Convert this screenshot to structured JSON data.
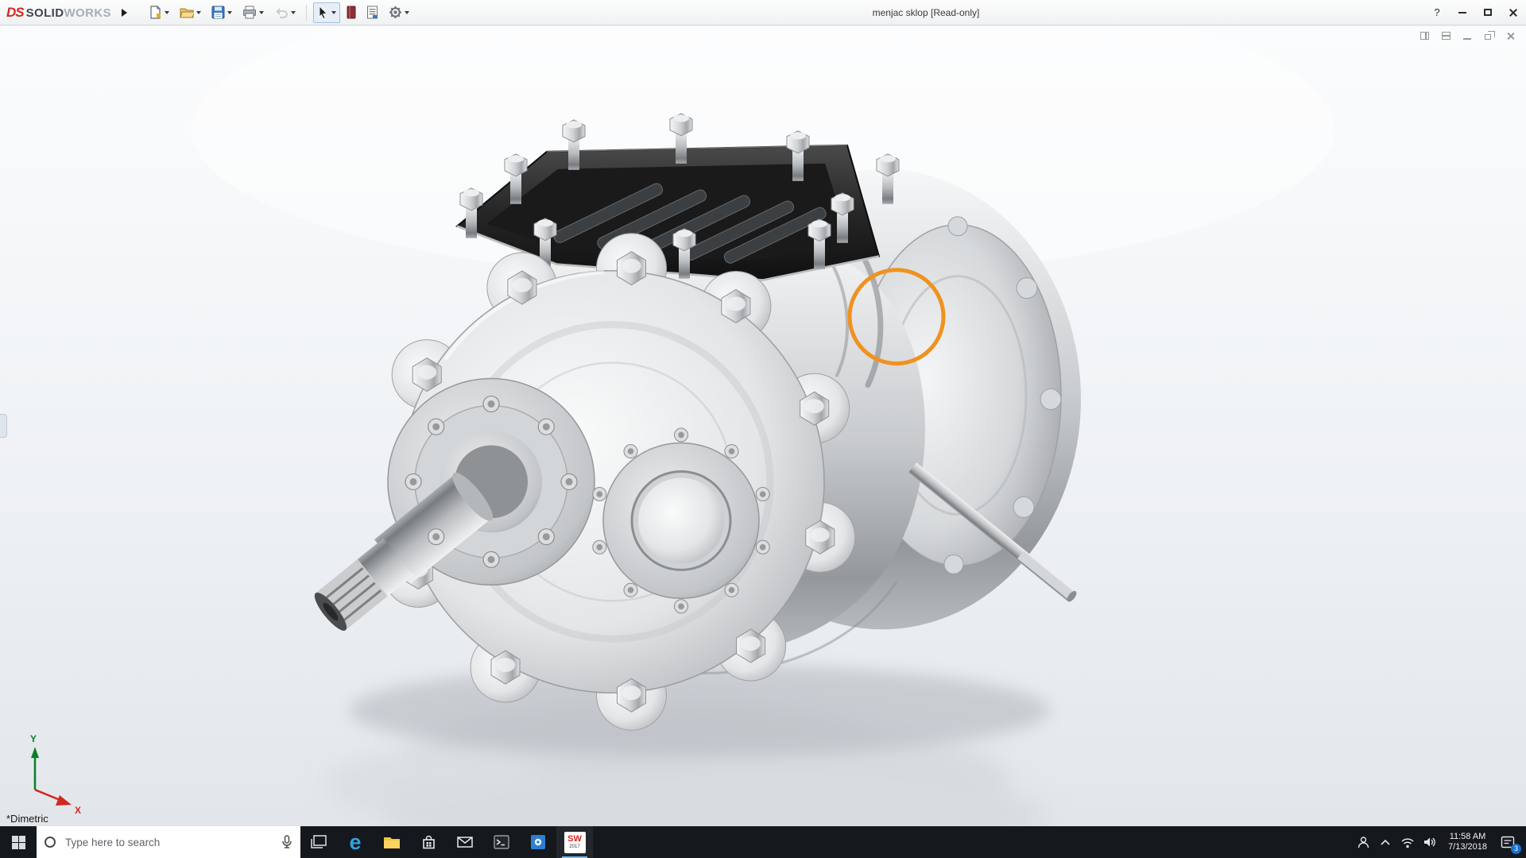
{
  "titlebar": {
    "logo_mark": "DS",
    "logo_solid": "SOLID",
    "logo_works": "WORKS",
    "title": "menjac sklop [Read-only]",
    "help_label": "?",
    "toolbar_icons": [
      "new-document",
      "open-document",
      "save",
      "print",
      "undo",
      "select-cursor",
      "xpress-products",
      "design-binder",
      "options-gear"
    ],
    "window_controls": [
      "help",
      "minimize",
      "maximize",
      "close"
    ]
  },
  "viewport": {
    "view_label": "*Dimetric",
    "doc_window_controls": [
      "split-pane-vertical",
      "split-pane-horizontal",
      "minimize",
      "restore",
      "close"
    ],
    "annotation": {
      "type": "circle",
      "color": "#F0921E"
    },
    "triad": {
      "x_label": "X",
      "y_label": "Y",
      "x_color": "#d2281e",
      "y_color": "#0c7d28"
    },
    "model": {
      "name": "gearbox-assembly",
      "metal_light": "#f4f5f6",
      "metal_mid": "#c9ccd0",
      "metal_dark": "#8f9296",
      "cover_dark": "#262626",
      "background_top": "#fbfcfd",
      "background_bottom": "#e2e6ea"
    }
  },
  "taskbar": {
    "start": "start-button",
    "search": {
      "placeholder": "Type here to search"
    },
    "apps": [
      "task-view",
      "edge",
      "file-explorer",
      "store",
      "mail",
      "command-prompt",
      "photos",
      "solidworks-2017"
    ],
    "edge_glyph": "e",
    "sw_label": "SW",
    "sw_year": "2017",
    "tray_icons": [
      "people",
      "chevron-up",
      "network",
      "volume",
      "clock",
      "action-center"
    ],
    "tray": {
      "time": "11:58 AM",
      "date": "7/13/2018",
      "notification_count": "3"
    }
  }
}
